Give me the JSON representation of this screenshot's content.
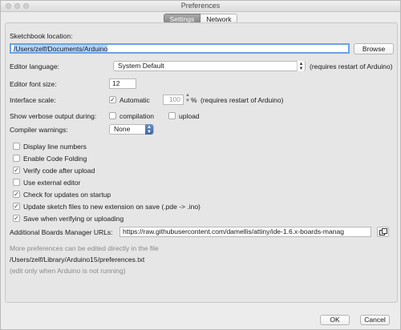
{
  "window": {
    "title": "Preferences"
  },
  "tabs": [
    {
      "label": "Settings",
      "active": true
    },
    {
      "label": "Network",
      "active": false
    }
  ],
  "sketchbook": {
    "label": "Sketchbook location:",
    "path": "/Users/zelf/Documents/Arduino",
    "browse_label": "Browse"
  },
  "language": {
    "label": "Editor language:",
    "value": "System Default",
    "note": "(requires restart of Arduino)"
  },
  "font_size": {
    "label": "Editor font size:",
    "value": "12"
  },
  "scale": {
    "label": "Interface scale:",
    "automatic_label": "Automatic",
    "automatic_checked": true,
    "value": "100",
    "unit": "%",
    "note": "(requires restart of Arduino)"
  },
  "verbose": {
    "label": "Show verbose output during:",
    "compilation_label": "compilation",
    "compilation_checked": false,
    "upload_label": "upload",
    "upload_checked": false
  },
  "warnings": {
    "label": "Compiler warnings:",
    "value": "None"
  },
  "options": [
    {
      "label": "Display line numbers",
      "checked": false
    },
    {
      "label": "Enable Code Folding",
      "checked": false
    },
    {
      "label": "Verify code after upload",
      "checked": true
    },
    {
      "label": "Use external editor",
      "checked": false
    },
    {
      "label": "Check for updates on startup",
      "checked": true
    },
    {
      "label": "Update sketch files to new extension on save (.pde -> .ino)",
      "checked": true
    },
    {
      "label": "Save when verifying or uploading",
      "checked": true
    }
  ],
  "boards": {
    "label": "Additional Boards Manager URLs:",
    "value": "https://raw.githubusercontent.com/damellis/attiny/ide-1.6.x-boards-manag"
  },
  "more_prefs": {
    "line1": "More preferences can be edited directly in the file",
    "path": "/Users/zelf/Library/Arduino15/preferences.txt",
    "line3": "(edit only when Arduino is not running)"
  },
  "footer": {
    "ok_label": "OK",
    "cancel_label": "Cancel"
  }
}
